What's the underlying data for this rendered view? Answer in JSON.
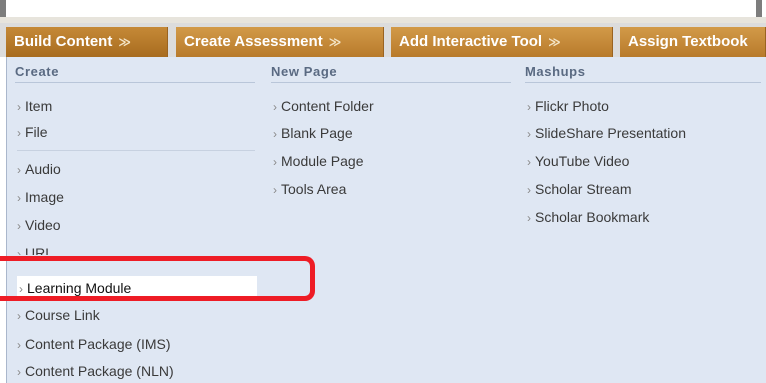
{
  "toolbar": {
    "tabs": [
      {
        "label": "Build Content"
      },
      {
        "label": "Create Assessment"
      },
      {
        "label": "Add Interactive Tool"
      },
      {
        "label": "Assign Textbook"
      }
    ],
    "chevron_glyph": "≫"
  },
  "menu": {
    "create": {
      "heading": "Create",
      "items": [
        "Item",
        "File",
        "Audio",
        "Image",
        "Video",
        "URL",
        "Learning Module",
        "Course Link",
        "Content Package (IMS)",
        "Content Package (NLN)"
      ]
    },
    "new_page": {
      "heading": "New Page",
      "items": [
        "Content Folder",
        "Blank Page",
        "Module Page",
        "Tools Area"
      ]
    },
    "mashups": {
      "heading": "Mashups",
      "items": [
        "Flickr Photo",
        "SlideShare Presentation",
        "YouTube Video",
        "Scholar Stream",
        "Scholar Bookmark"
      ]
    }
  },
  "colors": {
    "tab_bg": "#c48837",
    "menu_bg": "#dfe7f3",
    "callout": "#ee1c25",
    "tab_underline": "#2b4e7e"
  },
  "highlighted_item": "Learning Module"
}
